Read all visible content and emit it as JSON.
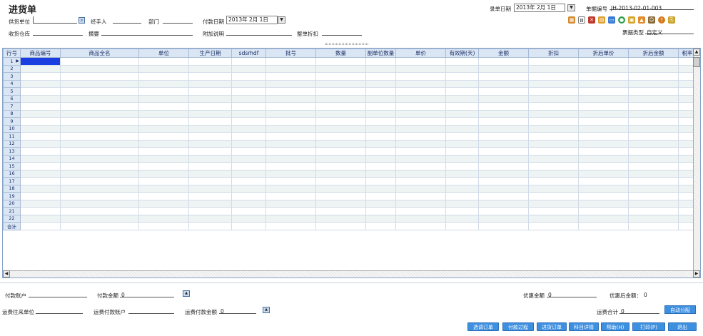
{
  "header": {
    "title": "进货单",
    "entry_date_label": "录单日期",
    "entry_date_value": "2013年 2月 1日",
    "doc_no_label": "单据编号",
    "doc_no_value": "JH-2013-02-01-003"
  },
  "form": {
    "supplier_label": "供货单位",
    "handler_label": "经手人",
    "dept_label": "部门",
    "pay_date_label": "付款日期",
    "pay_date_value": "2013年 2月 1日",
    "warehouse_label": "收货仓库",
    "summary_label": "摘要",
    "remark_label": "附加说明",
    "discount_label": "整单折扣",
    "bill_type_label": "票据类型",
    "bill_type_value": "自定义"
  },
  "grid": {
    "columns": [
      "行号",
      "商品编号",
      "商品全名",
      "单位",
      "生产日期",
      "sdsrhdf",
      "批号",
      "数量",
      "副单位数量",
      "单价",
      "有效期(天)",
      "金额",
      "折扣",
      "折后单价",
      "折后金额",
      "税率"
    ],
    "rows": [
      "1",
      "2",
      "3",
      "4",
      "5",
      "6",
      "7",
      "8",
      "9",
      "10",
      "11",
      "12",
      "13",
      "14",
      "15",
      "16",
      "17",
      "18",
      "19",
      "20",
      "21",
      "22"
    ],
    "total_label": "合计"
  },
  "footer": {
    "pay_account_label": "付款账户",
    "pay_amount_label": "付款金额",
    "pay_amount_value": "0",
    "discount_amount_label": "优惠金额",
    "discount_amount_value": "0",
    "after_discount_label": "优惠后金额：",
    "after_discount_value": "0",
    "freight_unit_label": "运费往来单位",
    "freight_account_label": "运费付款账户",
    "freight_pay_label": "运费付款金额",
    "freight_pay_value": "0",
    "freight_total_label": "运费合计",
    "freight_total_value": "0",
    "auto_alloc_label": "自动分配"
  },
  "actions": {
    "order_lookup": "选调订单",
    "pay_process": "付款过程",
    "purchase_order": "进货订单",
    "subject_detail": "科目详情",
    "help": "帮助(H)",
    "print": "打印(P)",
    "exit": "退出"
  },
  "colors": {
    "accent": "#3d8fe0",
    "header_bg": "#dbe6f4",
    "selection": "#1a3ee0"
  }
}
